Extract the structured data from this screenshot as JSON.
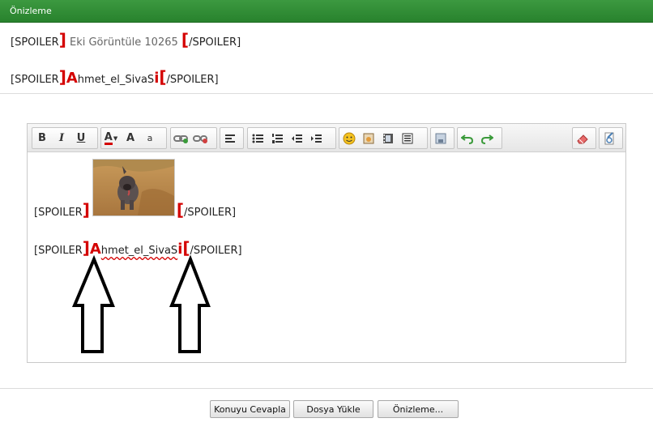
{
  "window": {
    "title": "Önizleme"
  },
  "preview": {
    "line1": {
      "open": "[SPOILER",
      "bracket_close": "]",
      "attachment": "Eki Görüntüle 10265",
      "bracket_open": "[",
      "close": "/SPOILER]"
    },
    "line2": {
      "open": "[SPOILER",
      "bracket_close": "]",
      "big_letter": "A",
      "name": "hmet_el_SivaS",
      "letter_i": "i",
      "bracket_open": "[",
      "close": "/SPOILER]"
    }
  },
  "editor": {
    "line1": {
      "open": "[SPOILER",
      "bracket_close": "]",
      "bracket_open": "[",
      "close": "/SPOILER]"
    },
    "line2": {
      "open": "[SPOILER",
      "bracket_close": "]",
      "big_letter": "A",
      "name": "hmet_el_SivaS",
      "letter_i": "i",
      "bracket_open": "[",
      "close": "/SPOILER]"
    },
    "toolbar": {
      "bold": "B",
      "italic": "I",
      "underline": "U",
      "font_color_glyph": "A",
      "font_size_glyph": "A",
      "font_glyph": "a",
      "icons": [
        "bold-icon",
        "italic-icon",
        "underline-icon",
        "font-color-icon",
        "font-size-icon",
        "font-icon",
        "link-icon",
        "unlink-icon",
        "align-icon",
        "bullet-list-icon",
        "numbered-list-icon",
        "outdent-icon",
        "indent-icon",
        "smiley-icon",
        "image-icon",
        "video-icon",
        "quote-icon",
        "save-icon",
        "undo-icon",
        "redo-icon",
        "eraser-icon",
        "source-icon"
      ]
    }
  },
  "buttons": {
    "reply": "Konuyu Cevapla",
    "upload": "Dosya Yükle",
    "preview": "Önizleme..."
  },
  "colors": {
    "title_bar": "#2e8b33",
    "accent_red": "#d40000"
  }
}
